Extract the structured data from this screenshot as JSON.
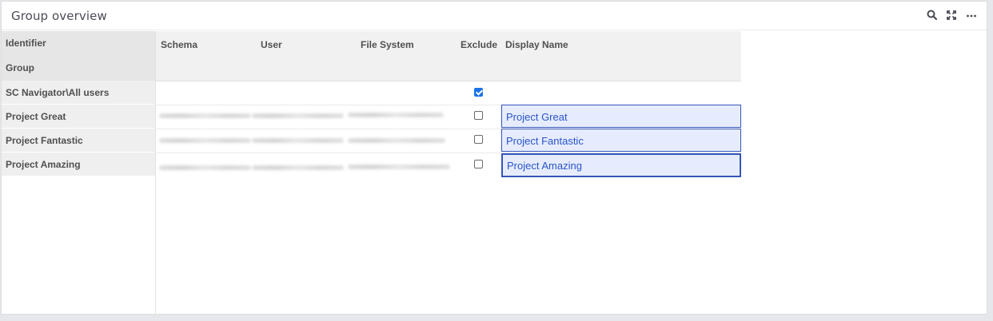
{
  "header": {
    "title": "Group overview"
  },
  "icons": {
    "search": "search-icon",
    "expand": "expand-icon",
    "more": "more-icon"
  },
  "left_headers": {
    "identifier": "Identifier",
    "group": "Group"
  },
  "grid_headers": {
    "schema": "Schema",
    "user": "User",
    "file_system": "File System",
    "exclude": "Exclude",
    "display_name": "Display Name"
  },
  "rows": [
    {
      "group": "SC Navigator\\All users",
      "exclude": true,
      "display_name": ""
    },
    {
      "group": "Project Great",
      "exclude": false,
      "display_name": "Project Great"
    },
    {
      "group": "Project Fantastic",
      "exclude": false,
      "display_name": "Project Fantastic"
    },
    {
      "group": "Project Amazing",
      "exclude": false,
      "display_name": "Project Amazing"
    }
  ],
  "colors": {
    "accent": "#1a73e8",
    "input_bg": "#e6ecfd",
    "input_border": "#3556b8"
  }
}
